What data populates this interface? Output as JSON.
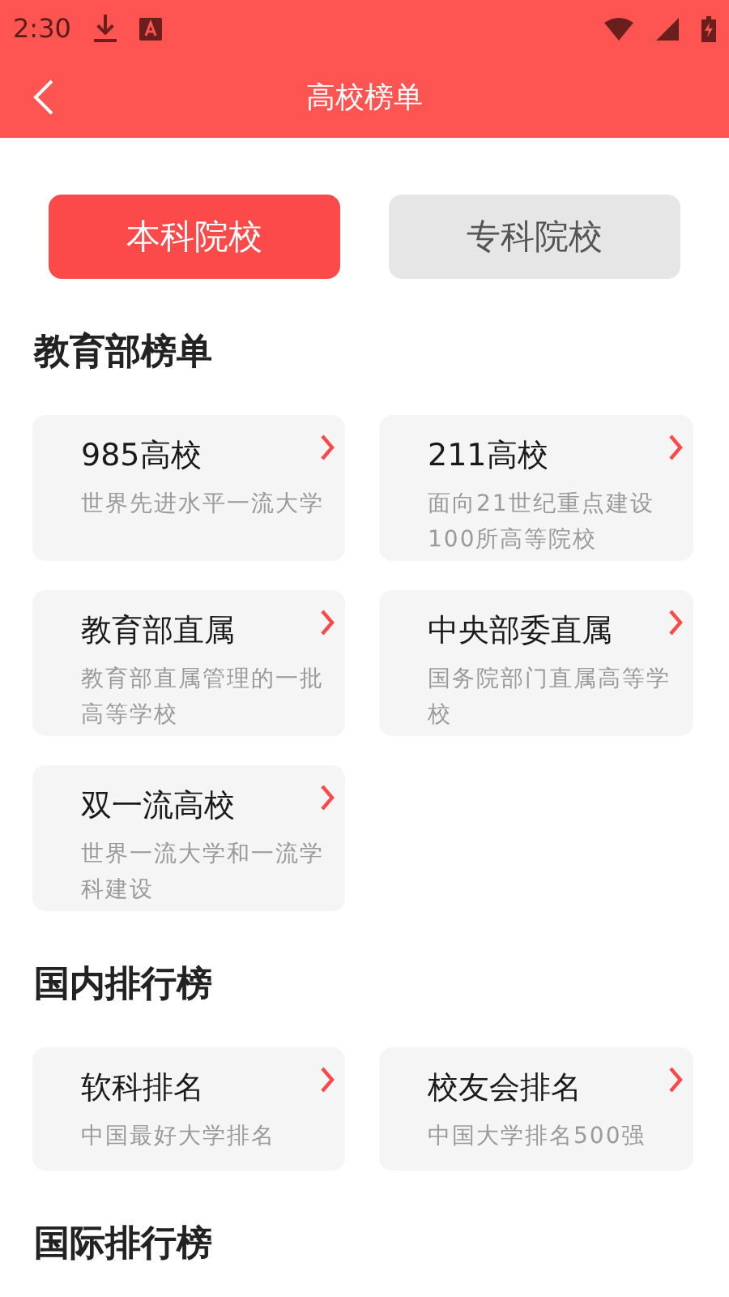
{
  "status_bar": {
    "time": "2:30"
  },
  "app_bar": {
    "title": "高校榜单"
  },
  "tabs": [
    {
      "label": "本科院校",
      "selected": true
    },
    {
      "label": "专科院校",
      "selected": false
    }
  ],
  "sections": [
    {
      "title": "教育部榜单",
      "cards": [
        {
          "title": "985高校",
          "description": "世界先进水平一流大学"
        },
        {
          "title": "211高校",
          "description": "面向21世纪重点建设100所高等院校"
        },
        {
          "title": "教育部直属",
          "description": "教育部直属管理的一批高等学校"
        },
        {
          "title": "中央部委直属",
          "description": "国务院部门直属高等学校"
        },
        {
          "title": "双一流高校",
          "description": "世界一流大学和一流学科建设"
        }
      ]
    },
    {
      "title": "国内排行榜",
      "cards": [
        {
          "title": "软科排名",
          "description": "中国最好大学排名"
        },
        {
          "title": "校友会排名",
          "description": "中国大学排名500强"
        }
      ]
    },
    {
      "title": "国际排行榜"
    }
  ]
}
